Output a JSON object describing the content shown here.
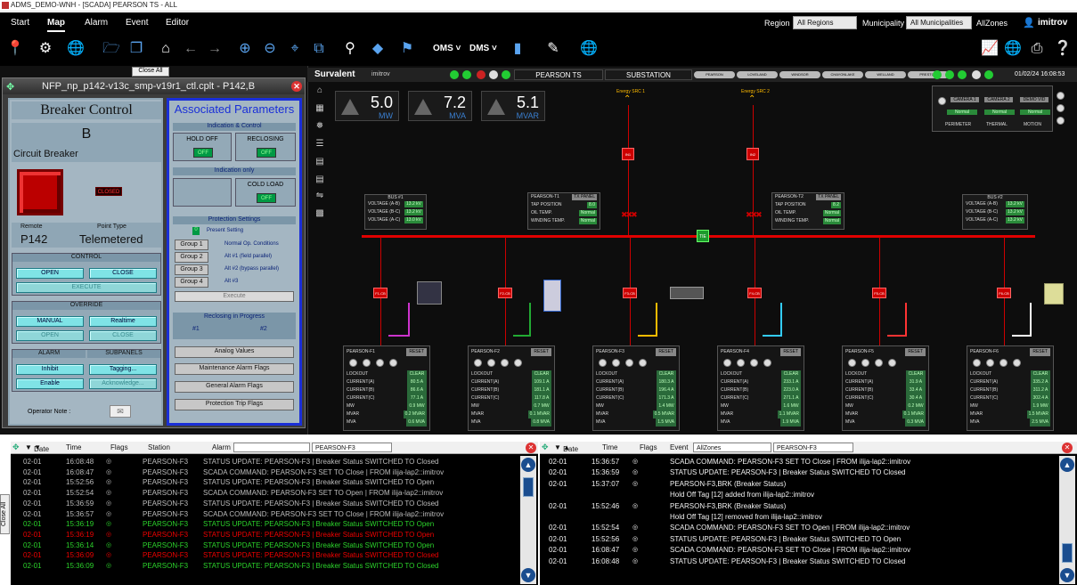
{
  "window_title": "ADMS_DEMO-WNH - [SCADA] PEARSON TS - ALL",
  "menu": {
    "items": [
      "Start",
      "Map",
      "Alarm",
      "Event",
      "Editor"
    ],
    "active": "Map",
    "region_label": "Region",
    "region_value": "All Regions",
    "municipality_label": "Municipality",
    "municipality_value": "All Municipalities",
    "allzones_label": "AllZones",
    "user": "imitrov"
  },
  "toolbar": {
    "oms_label": "OMS",
    "dms_label": "DMS"
  },
  "close_all_label": "Close All",
  "popup": {
    "title": "NFP_np_p142-v13c_smp-v19r1_ctl.cplt - P142,B",
    "breaker_control": {
      "heading": "Breaker Control",
      "phase": "B",
      "device": "Circuit Breaker",
      "state": "CLOSED",
      "remote_label": "Remote",
      "remote_value": "P142",
      "point_type_label": "Point Type",
      "point_type_value": "Telemetered",
      "control_label": "CONTROL",
      "open": "OPEN",
      "close": "CLOSE",
      "execute": "EXECUTE",
      "override_label": "OVERRIDE",
      "manual": "MANUAL",
      "realtime": "Realtime",
      "ov_open": "OPEN",
      "ov_close": "CLOSE",
      "alarm_label": "ALARM",
      "subpanels_label": "SUBPANELS",
      "inhibit": "Inhibit",
      "tagging": "Tagging...",
      "enable": "Enable",
      "acknowledge": "Acknowledge...",
      "operator_note": "Operator Note :"
    },
    "assoc": {
      "heading": "Associated Parameters",
      "ind_ctrl": "Indication & Control",
      "hold_off": "HOLD OFF",
      "reclosing": "RECLOSING",
      "off": "OFF",
      "ind_only": "Indication only",
      "cold_load": "COLD LOAD",
      "prot_settings": "Protection Settings",
      "present_setting": "Present Setting",
      "present_value": "0",
      "groups": [
        {
          "btn": "Group 1",
          "desc": "Normal Op. Conditions"
        },
        {
          "btn": "Group 2",
          "desc": "Alt #1 (field parallel)"
        },
        {
          "btn": "Group 3",
          "desc": "Alt #2 (bypass parallel)"
        },
        {
          "btn": "Group 4",
          "desc": "Alt #3"
        }
      ],
      "execute": "Execute",
      "reclosing_progress": "Reclosing in Progress",
      "rc1": "#1",
      "rc2": "#2",
      "analog": "Analog Values",
      "maint": "Maintenance Alarm Flags",
      "general": "General Alarm Flags",
      "prot_trip": "Protection Trip Flags"
    }
  },
  "scada": {
    "brand": "Survalent",
    "user": "imitrov",
    "station": "PEARSON TS",
    "type": "SUBSTATION",
    "feeders_nav": [
      "PEARSON",
      "LOVELAND",
      "WINDSOR",
      "CHAYONLAKE",
      "WELLAND",
      "PRESTON"
    ],
    "datetime": "01/02/24 16:08:53",
    "meters": [
      {
        "value": "5.0",
        "unit": "MW"
      },
      {
        "value": "7.2",
        "unit": "MVA"
      },
      {
        "value": "5.1",
        "unit": "MVAR"
      }
    ],
    "cameras": [
      {
        "name": "CAMERA 1",
        "status": "Normal",
        "area": "PERIMETER"
      },
      {
        "name": "CAMERA 2",
        "status": "Normal",
        "area": "THERMAL"
      },
      {
        "name": "DEMO VID",
        "status": "Normal",
        "area": "MOTION"
      }
    ],
    "energy_src": [
      "Energy SRC 1",
      "Energy SRC 2"
    ],
    "bus1": {
      "name": "BUS #1",
      "rows": [
        {
          "k": "VOLTAGE (A-B)",
          "v": "13.2 kV"
        },
        {
          "k": "VOLTAGE (B-C)",
          "v": "13.2 kV"
        },
        {
          "k": "VOLTAGE (A-C)",
          "v": "13.0 kV"
        }
      ]
    },
    "bus2": {
      "name": "BUS #2",
      "rows": [
        {
          "k": "VOLTAGE (A-B)",
          "v": "13.2 kV"
        },
        {
          "k": "VOLTAGE (B-C)",
          "v": "13.2 kV"
        },
        {
          "k": "VOLTAGE (A-C)",
          "v": "13.2 kV"
        }
      ]
    },
    "t1": {
      "name": "PEARSON-T1",
      "panel": "TX PANEL",
      "rows": [
        {
          "k": "TAP POSITION",
          "v": "8.0"
        },
        {
          "k": "OIL TEMP.",
          "v": "Normal"
        },
        {
          "k": "WINDING TEMP.",
          "v": "Normal"
        }
      ]
    },
    "t2": {
      "name": "PEARSON-T2",
      "panel": "TX PANEL",
      "rows": [
        {
          "k": "TAP POSITION",
          "v": "8.2"
        },
        {
          "k": "OIL TEMP.",
          "v": "Normal"
        },
        {
          "k": "WINDING TEMP.",
          "v": "Normal"
        }
      ]
    },
    "breakers_top": [
      "IN1",
      "IN2"
    ],
    "tie": "TIE",
    "feeder_breakers": [
      "F1-CB",
      "F2-CB",
      "F3-CB",
      "F4-CB",
      "F5-CB",
      "F6-CB"
    ],
    "feeders": [
      {
        "name": "PEARSON-F1",
        "reset": "RESET",
        "rows": [
          {
            "k": "LOCKOUT",
            "v": "CLEAR"
          },
          {
            "k": "CURRENT(A)",
            "v": "80.5 A"
          },
          {
            "k": "CURRENT(B)",
            "v": "86.6 A"
          },
          {
            "k": "CURRENT(C)",
            "v": "77.1 A"
          },
          {
            "k": "MW",
            "v": "0.9 MW"
          },
          {
            "k": "MVAR",
            "v": "0.2 MVAR"
          },
          {
            "k": "MVA",
            "v": "0.6 MVA"
          }
        ]
      },
      {
        "name": "PEARSON-F2",
        "reset": "RESET",
        "rows": [
          {
            "k": "LOCKOUT",
            "v": "CLEAR"
          },
          {
            "k": "CURRENT(A)",
            "v": "109.1 A"
          },
          {
            "k": "CURRENT(B)",
            "v": "181.1 A"
          },
          {
            "k": "CURRENT(C)",
            "v": "117.8 A"
          },
          {
            "k": "MW",
            "v": "0.7 MW"
          },
          {
            "k": "MVAR",
            "v": "0.1 MVAR"
          },
          {
            "k": "MVA",
            "v": "0.8 MVA"
          }
        ]
      },
      {
        "name": "PEARSON-F3",
        "reset": "RESET",
        "rows": [
          {
            "k": "LOCKOUT",
            "v": "CLEAR"
          },
          {
            "k": "CURRENT(A)",
            "v": "180.3 A"
          },
          {
            "k": "CURRENT(B)",
            "v": "196.4 A"
          },
          {
            "k": "CURRENT(C)",
            "v": "171.3 A"
          },
          {
            "k": "MW",
            "v": "1.4 MW"
          },
          {
            "k": "MVAR",
            "v": "0.5 MVAR"
          },
          {
            "k": "MVA",
            "v": "1.5 MVA"
          }
        ]
      },
      {
        "name": "PEARSON-F4",
        "reset": "RESET",
        "rows": [
          {
            "k": "LOCKOUT",
            "v": "CLEAR"
          },
          {
            "k": "CURRENT(A)",
            "v": "233.1 A"
          },
          {
            "k": "CURRENT(B)",
            "v": "223.0 A"
          },
          {
            "k": "CURRENT(C)",
            "v": "271.1 A"
          },
          {
            "k": "MW",
            "v": "1.6 MW"
          },
          {
            "k": "MVAR",
            "v": "1.1 MVAR"
          },
          {
            "k": "MVA",
            "v": "1.9 MVA"
          }
        ]
      },
      {
        "name": "PEARSON-F5",
        "reset": "RESET",
        "rows": [
          {
            "k": "LOCKOUT",
            "v": "CLEAR"
          },
          {
            "k": "CURRENT(A)",
            "v": "31.9 A"
          },
          {
            "k": "CURRENT(B)",
            "v": "33.4 A"
          },
          {
            "k": "CURRENT(C)",
            "v": "30.4 A"
          },
          {
            "k": "MW",
            "v": "0.2 MW"
          },
          {
            "k": "MVAR",
            "v": "0.1 MVAR"
          },
          {
            "k": "MVA",
            "v": "0.3 MVA"
          }
        ]
      },
      {
        "name": "PEARSON-F6",
        "reset": "RESET",
        "rows": [
          {
            "k": "LOCKOUT",
            "v": "CLEAR"
          },
          {
            "k": "CURRENT(A)",
            "v": "335.2 A"
          },
          {
            "k": "CURRENT(B)",
            "v": "311.2 A"
          },
          {
            "k": "CURRENT(C)",
            "v": "302.4 A"
          },
          {
            "k": "MW",
            "v": "1.9 MW"
          },
          {
            "k": "MVAR",
            "v": "1.5 MVAR"
          },
          {
            "k": "MVA",
            "v": "2.5 MVA"
          }
        ]
      }
    ]
  },
  "alarm_log": {
    "headers": {
      "date": "Date",
      "time": "Time",
      "flags": "Flags",
      "station": "Station",
      "alarm": "Alarm"
    },
    "filter": "PEARSON-F3",
    "rows": [
      {
        "d": "02-01",
        "t": "16:08:48",
        "s": "PEARSON-F3",
        "m": "STATUS UPDATE: PEARSON-F3  |  Breaker Status SWITCHED TO  Closed",
        "c": "gray"
      },
      {
        "d": "02-01",
        "t": "16:08:47",
        "s": "PEARSON-F3",
        "m": "SCADA COMMAND: PEARSON-F3 SET TO Close  |  FROM ilija-lap2::imitrov",
        "c": "gray"
      },
      {
        "d": "02-01",
        "t": "15:52:56",
        "s": "PEARSON-F3",
        "m": "STATUS UPDATE: PEARSON-F3  |  Breaker Status SWITCHED TO  Open",
        "c": "gray"
      },
      {
        "d": "02-01",
        "t": "15:52:54",
        "s": "PEARSON-F3",
        "m": "SCADA COMMAND: PEARSON-F3 SET TO Open  |  FROM ilija-lap2::imitrov",
        "c": "gray"
      },
      {
        "d": "02-01",
        "t": "15:36:59",
        "s": "PEARSON-F3",
        "m": "STATUS UPDATE: PEARSON-F3  |  Breaker Status SWITCHED TO  Closed",
        "c": "gray"
      },
      {
        "d": "02-01",
        "t": "15:36:57",
        "s": "PEARSON-F3",
        "m": "SCADA COMMAND: PEARSON-F3 SET TO Close  |  FROM ilija-lap2::imitrov",
        "c": "gray"
      },
      {
        "d": "02-01",
        "t": "15:36:19",
        "s": "PEARSON-F3",
        "m": "STATUS UPDATE: PEARSON-F3  |  Breaker Status SWITCHED TO  Open",
        "c": "green"
      },
      {
        "d": "02-01",
        "t": "15:36:19",
        "s": "PEARSON-F3",
        "m": "STATUS UPDATE: PEARSON-F3  |  Breaker Status SWITCHED TO  Open",
        "c": "red"
      },
      {
        "d": "02-01",
        "t": "15:36:14",
        "s": "PEARSON-F3",
        "m": "STATUS UPDATE: PEARSON-F3  |  Breaker Status SWITCHED TO  Open",
        "c": "green"
      },
      {
        "d": "02-01",
        "t": "15:36:09",
        "s": "PEARSON-F3",
        "m": "STATUS UPDATE: PEARSON-F3  |  Breaker Status SWITCHED TO  Closed",
        "c": "red"
      },
      {
        "d": "02-01",
        "t": "15:36:09",
        "s": "PEARSON-F3",
        "m": "STATUS UPDATE: PEARSON-F3  |  Breaker Status SWITCHED TO  Closed",
        "c": "green"
      }
    ]
  },
  "event_log": {
    "headers": {
      "date": "Date",
      "time": "Time",
      "flags": "Flags",
      "event": "Event"
    },
    "zone": "AllZones",
    "filter": "PEARSON-F3",
    "rows": [
      {
        "d": "02-01",
        "t": "15:36:57",
        "m": "SCADA COMMAND: PEARSON-F3 SET TO Close  |  FROM ilija-lap2::imitrov"
      },
      {
        "d": "02-01",
        "t": "15:36:59",
        "m": "STATUS UPDATE: PEARSON-F3  |  Breaker Status SWITCHED TO  Closed"
      },
      {
        "d": "02-01",
        "t": "15:37:07",
        "m": "PEARSON-F3,BRK (Breaker Status)"
      },
      {
        "d": "",
        "t": "",
        "m": "Hold Off Tag [12] added from ilija-lap2::imitrov"
      },
      {
        "d": "02-01",
        "t": "15:52:46",
        "m": "PEARSON-F3,BRK (Breaker Status)"
      },
      {
        "d": "",
        "t": "",
        "m": "Hold Off Tag [12] removed from ilija-lap2::imitrov"
      },
      {
        "d": "02-01",
        "t": "15:52:54",
        "m": "SCADA COMMAND: PEARSON-F3 SET TO Open  |  FROM ilija-lap2::imitrov"
      },
      {
        "d": "02-01",
        "t": "15:52:56",
        "m": "STATUS UPDATE: PEARSON-F3  |  Breaker Status SWITCHED TO  Open"
      },
      {
        "d": "02-01",
        "t": "16:08:47",
        "m": "SCADA COMMAND: PEARSON-F3 SET TO Close  |  FROM ilija-lap2::imitrov"
      },
      {
        "d": "02-01",
        "t": "16:08:48",
        "m": "STATUS UPDATE: PEARSON-F3  |  Breaker Status SWITCHED TO  Closed"
      }
    ]
  },
  "colors": {
    "bus": "#e00000",
    "accent": "#1a4d8f"
  }
}
